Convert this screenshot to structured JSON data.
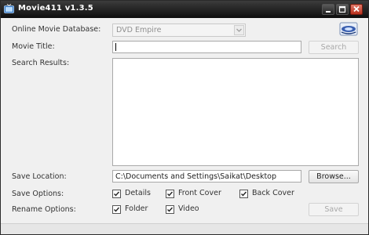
{
  "window": {
    "title": "Movie411 v1.3.5"
  },
  "form": {
    "db_label": "Online Movie Database:",
    "db_value": "DVD Empire",
    "title_label": "Movie Title:",
    "title_value": "",
    "search_label": "Search",
    "results_label": "Search Results:",
    "save_location_label": "Save Location:",
    "save_location_value": "C:\\Documents and Settings\\Saikat\\Desktop",
    "browse_label": "Browse...",
    "save_options_label": "Save Options:",
    "save_options": [
      {
        "label": "Details",
        "checked": true
      },
      {
        "label": "Front Cover",
        "checked": true
      },
      {
        "label": "Back Cover",
        "checked": true
      }
    ],
    "rename_options_label": "Rename Options:",
    "rename_options": [
      {
        "label": "Folder",
        "checked": true
      },
      {
        "label": "Video",
        "checked": true
      }
    ],
    "save_label": "Save"
  },
  "icons": {
    "app": "tv-icon",
    "db_logo": "dvd-empire-logo-icon",
    "dropdown": "chevron-down-icon",
    "minimize": "minimize-icon",
    "maximize": "maximize-icon",
    "close": "close-icon"
  },
  "colors": {
    "titlebar": "#1a1a1a",
    "window_bg": "#f0f0f0",
    "close_button": "#c9402b"
  }
}
